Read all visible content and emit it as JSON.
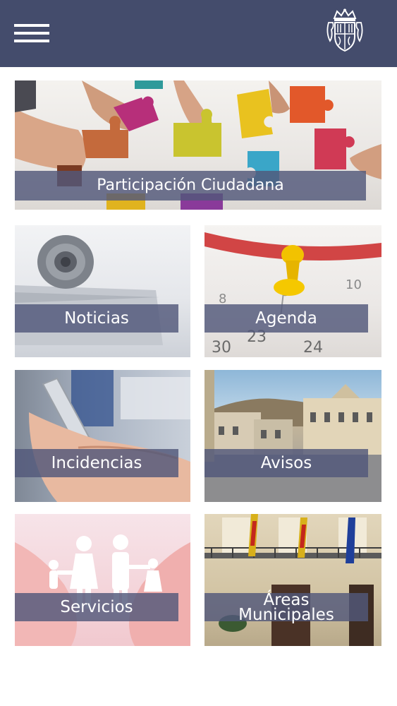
{
  "header": {
    "menu_icon": "hamburger-menu-icon",
    "logo_icon": "coat-of-arms-icon",
    "background_color": "#444c6c"
  },
  "tiles": {
    "participacion": {
      "label": "Participación Ciudadana",
      "image": "puzzle-pieces-hands"
    },
    "noticias": {
      "label": "Noticias",
      "image": "rolled-newspaper"
    },
    "agenda": {
      "label": "Agenda",
      "image": "calendar-with-yellow-pin"
    },
    "incidencias": {
      "label": "Incidencias",
      "image": "hand-holding-smartphone"
    },
    "avisos": {
      "label": "Avisos",
      "image": "town-square-buildings"
    },
    "servicios": {
      "label": "Servicios",
      "image": "hands-holding-family-cutout"
    },
    "areas": {
      "label_line1": "Áreas",
      "label_line2": "Municipales",
      "image": "town-hall-facade-flags"
    }
  },
  "colors": {
    "label_overlay": "#52587a",
    "label_text": "#ffffff"
  }
}
